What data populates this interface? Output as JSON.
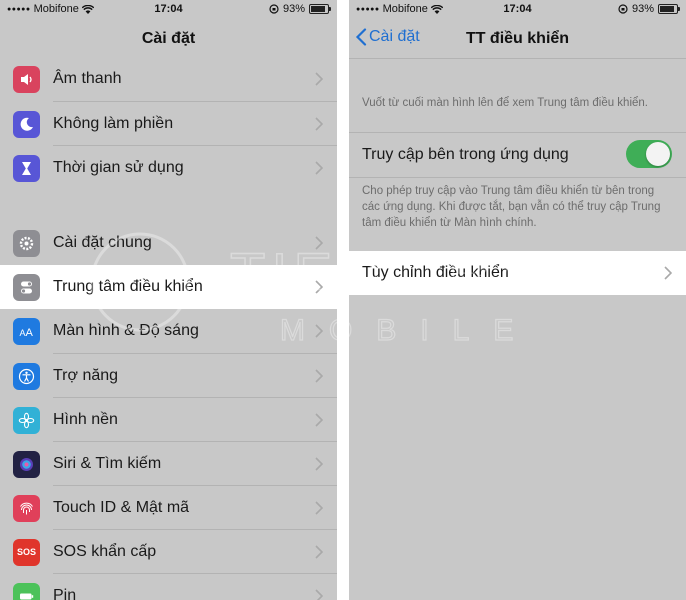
{
  "left": {
    "status": {
      "carrier": "Mobifone",
      "time": "17:04",
      "battery": "93%"
    },
    "title": "Cài đặt",
    "group1": [
      {
        "label": "Âm thanh",
        "icon": "sound-icon",
        "color": "#d9435e"
      },
      {
        "label": "Không làm phiền",
        "icon": "moon-icon",
        "color": "#5856d6"
      },
      {
        "label": "Thời gian sử dụng",
        "icon": "hourglass-icon",
        "color": "#5856d6"
      }
    ],
    "group2": [
      {
        "label": "Cài đặt chung",
        "icon": "gear-icon",
        "color": "#8e8e93"
      },
      {
        "label": "Trung tâm điều khiển",
        "icon": "toggles-icon",
        "color": "#8e8e93"
      },
      {
        "label": "Màn hình & Độ sáng",
        "icon": "text-size-icon",
        "color": "#1f7ae0"
      },
      {
        "label": "Trợ năng",
        "icon": "accessibility-icon",
        "color": "#1f7ae0"
      },
      {
        "label": "Hình nền",
        "icon": "flower-icon",
        "color": "#31b1d6"
      },
      {
        "label": "Siri & Tìm kiếm",
        "icon": "siri-icon",
        "color": "#222244"
      },
      {
        "label": "Touch ID & Mật mã",
        "icon": "fingerprint-icon",
        "color": "#e0405a"
      },
      {
        "label": "SOS khẩn cấp",
        "icon": "sos-icon",
        "color": "#e0352b"
      },
      {
        "label": "Pin",
        "icon": "battery-icon",
        "color": "#4cc25a"
      }
    ],
    "sos_text": "SOS"
  },
  "right": {
    "status": {
      "carrier": "Mobifone",
      "time": "17:04",
      "battery": "93%"
    },
    "back_label": "Cài đặt",
    "title": "TT điều khiển",
    "intro": "Vuốt từ cuối màn hình lên để xem Trung tâm điều khiển.",
    "toggle_label": "Truy cập bên trong ứng dụng",
    "toggle_on": true,
    "toggle_note": "Cho phép truy cập vào Trung tâm điều khiển từ bên trong các ứng dụng. Khi được tắt, bạn vẫn có thể truy cập Trung tâm điều khiển từ Màn hình chính.",
    "customize_label": "Tùy chỉnh điều khiển"
  },
  "colors": {
    "accent": "#1f6fd1",
    "toggle_on": "#3fae57",
    "background": "#c8c8c8",
    "highlight": "#ffffff"
  },
  "watermark": {
    "line1": "TIEN TRAN",
    "line2": "MOBILE"
  }
}
